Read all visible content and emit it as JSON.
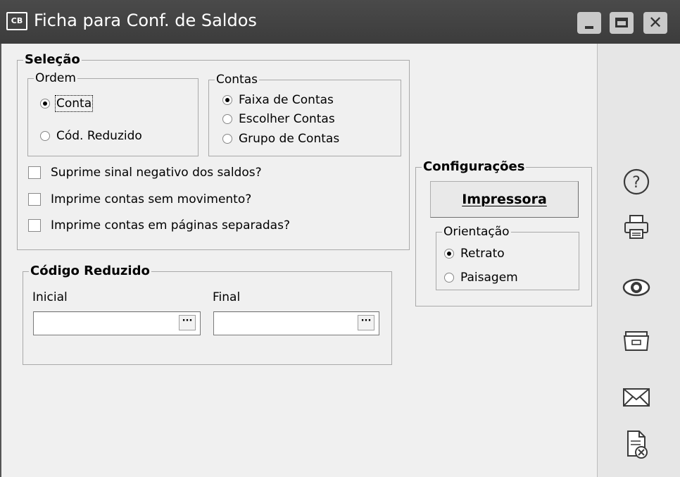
{
  "window": {
    "title": "Ficha para Conf. de Saldos",
    "app_icon_text": "CB"
  },
  "selecao": {
    "legend": "Seleção",
    "ordem": {
      "legend": "Ordem",
      "options": [
        {
          "label": "Conta",
          "selected": true
        },
        {
          "label": "Cód. Reduzido",
          "selected": false
        }
      ]
    },
    "contas": {
      "legend": "Contas",
      "options": [
        {
          "label": "Faixa de Contas",
          "selected": true
        },
        {
          "label": "Escolher Contas",
          "selected": false
        },
        {
          "label": "Grupo de Contas",
          "selected": false
        }
      ]
    },
    "checkboxes": [
      {
        "label": "Suprime sinal negativo dos saldos?",
        "checked": false
      },
      {
        "label": "Imprime contas sem movimento?",
        "checked": false
      },
      {
        "label": "Imprime contas em páginas separadas?",
        "checked": false
      }
    ]
  },
  "codigo_reduzido": {
    "legend": "Código Reduzido",
    "inicial_label": "Inicial",
    "final_label": "Final",
    "inicial_value": "",
    "final_value": "",
    "browse_glyph": "···"
  },
  "configuracoes": {
    "legend": "Configurações",
    "impressora_button": "Impressora",
    "orientacao": {
      "legend": "Orientação",
      "options": [
        {
          "label": "Retrato",
          "selected": true
        },
        {
          "label": "Paisagem",
          "selected": false
        }
      ]
    }
  },
  "sidebar_icons": [
    "help-icon",
    "printer-icon",
    "preview-icon",
    "folder-icon",
    "email-icon",
    "close-document-icon"
  ]
}
